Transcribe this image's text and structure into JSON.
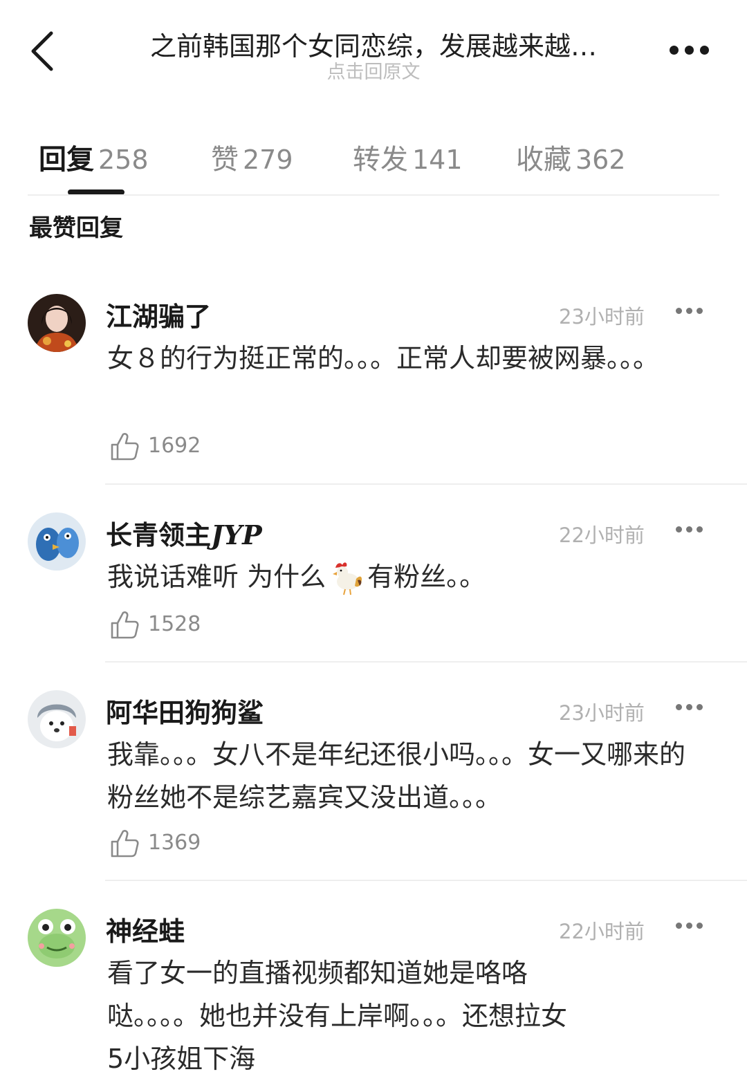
{
  "header": {
    "title": "之前韩国那个女同恋综，发展越来越…",
    "subtitle": "点击回原文"
  },
  "tabs": [
    {
      "label": "回复",
      "count": "258",
      "active": true
    },
    {
      "label": "赞",
      "count": "279",
      "active": false
    },
    {
      "label": "转发",
      "count": "141",
      "active": false
    },
    {
      "label": "收藏",
      "count": "362",
      "active": false
    }
  ],
  "section_title": "最赞回复",
  "comments": [
    {
      "name": "江湖骗了",
      "time": "23小时前",
      "text": "女８的行为挺正常的。。。正常人却要被网暴。。。",
      "likes": "1692"
    },
    {
      "name_prefix": "长青领主",
      "name_suffix": "JYP",
      "time": "22小时前",
      "text_before": "我说话难听 为什么",
      "emoji": "rooster-emoji",
      "text_after": "有粉丝。。",
      "likes": "1528"
    },
    {
      "name": "阿华田狗狗鲨",
      "time": "23小时前",
      "text": "我靠。。。女八不是年纪还很小吗。。。女一又哪来的粉丝她不是综艺嘉宾又没出道。。。",
      "likes": "1369"
    },
    {
      "name": "神经蛙",
      "time": "22小时前",
      "text_line1": "看了女一的直播视频都知道她是咯咯",
      "text_line2": "哒。。。。她也并没有上岸啊。。。还想拉女",
      "text_line3": "5小孩姐下海"
    }
  ],
  "icons": {
    "back": "chevron-left-icon",
    "more": "more-dots-icon",
    "like": "thumbs-up-icon"
  }
}
